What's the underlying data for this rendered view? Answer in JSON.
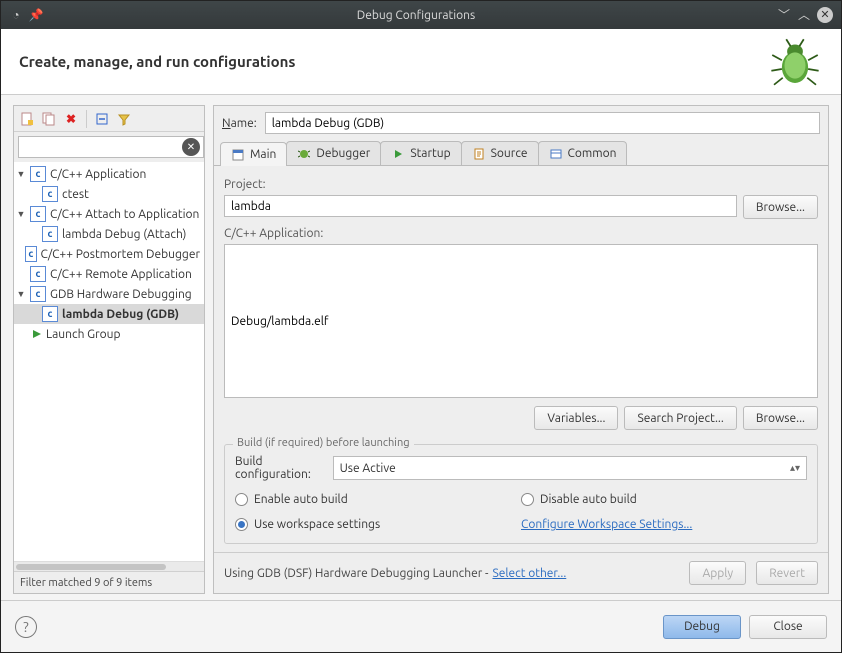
{
  "window": {
    "title": "Debug Configurations"
  },
  "header": {
    "title": "Create, manage, and run configurations"
  },
  "left": {
    "filter_value": "",
    "tree": {
      "n0": {
        "label": "C/C++ Application"
      },
      "n0_0": {
        "label": "ctest"
      },
      "n1": {
        "label": "C/C++ Attach to Application"
      },
      "n1_0": {
        "label": "lambda Debug (Attach)"
      },
      "n2": {
        "label": "C/C++ Postmortem Debugger"
      },
      "n3": {
        "label": "C/C++ Remote Application"
      },
      "n4": {
        "label": "GDB Hardware Debugging"
      },
      "n4_0": {
        "label": "lambda Debug (GDB)"
      },
      "n5": {
        "label": "Launch Group"
      }
    },
    "status": "Filter matched 9 of 9 items"
  },
  "right": {
    "name_label": "Name:",
    "name_value": "lambda Debug (GDB)",
    "tabs": {
      "main": "Main",
      "debugger": "Debugger",
      "startup": "Startup",
      "source": "Source",
      "common": "Common"
    },
    "project_label": "Project:",
    "project_value": "lambda",
    "browse": "Browse...",
    "app_label": "C/C++ Application:",
    "app_value": "Debug/lambda.elf",
    "variables": "Variables...",
    "search_project": "Search Project...",
    "group_title": "Build (if required) before launching",
    "build_cfg_label": "Build configuration:",
    "build_cfg_value": "Use Active",
    "radio_enable": "Enable auto build",
    "radio_disable": "Disable auto build",
    "radio_workspace": "Use workspace settings",
    "cfg_link": "Configure Workspace Settings...",
    "launcher_text": "Using GDB (DSF) Hardware Debugging Launcher - ",
    "launcher_link": "Select other...",
    "apply": "Apply",
    "revert": "Revert"
  },
  "footer": {
    "debug": "Debug",
    "close": "Close"
  }
}
